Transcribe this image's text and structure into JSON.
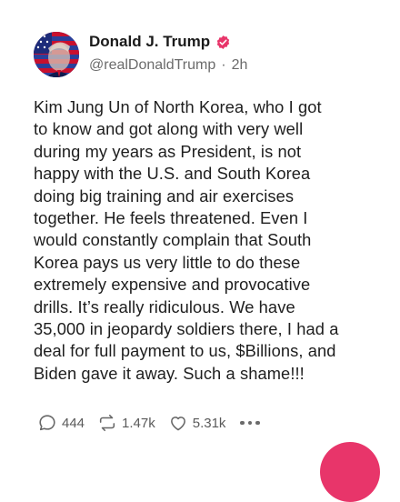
{
  "post": {
    "author_name": "Donald J. Trump",
    "handle": "@realDonaldTrump",
    "separator": "·",
    "time": "2h",
    "body_lines": [
      "Kim Jung Un of North Korea, who I got",
      "to know and got along with very well",
      "during my years as President, is not",
      "happy with the U.S. and South Korea",
      "doing big training and air exercises",
      "together. He feels threatened. Even I",
      "would constantly complain that South",
      "Korea pays us very little to do these",
      "extremely expensive and provocative",
      "drills. It’s really ridiculous. We have",
      "35,000 in jeopardy soldiers there, I had a",
      "deal for full payment to us, $Billions, and",
      "Biden gave it away. Such a shame!!!"
    ]
  },
  "actions": {
    "replies": "444",
    "reposts": "1.47k",
    "likes": "5.31k"
  },
  "icons": {
    "verified": "verified-badge-icon",
    "reply": "comment-bubble-icon",
    "repost": "repost-arrows-icon",
    "like": "heart-icon",
    "more": "ellipsis-icon"
  },
  "colors": {
    "verified": "#e8356a",
    "fab": "#e8356a",
    "muted_text": "#6b6b6b"
  }
}
